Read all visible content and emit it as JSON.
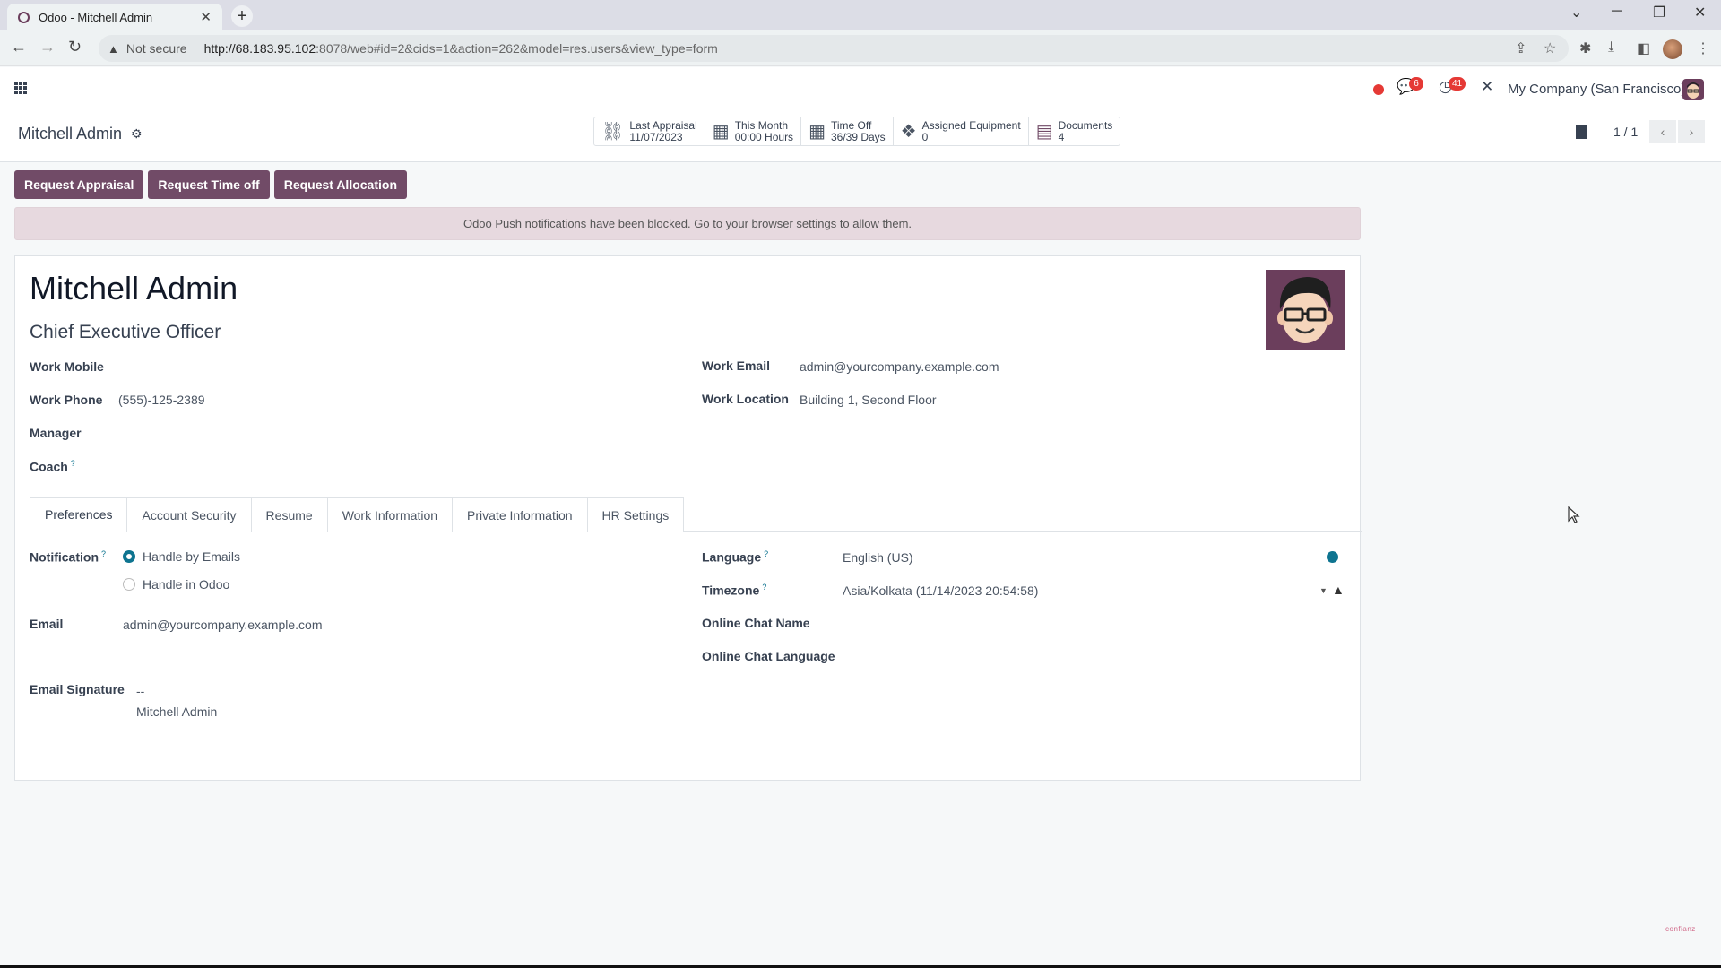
{
  "browser": {
    "tab_title": "Odoo - Mitchell Admin",
    "security_label": "Not secure",
    "url_host": "http://68.183.95.102",
    "url_rest": ":8078/web#id=2&cids=1&action=262&model=res.users&view_type=form"
  },
  "navbar": {
    "messages_badge": "6",
    "activities_badge": "41",
    "company": "My Company (San Francisco)"
  },
  "control_panel": {
    "breadcrumb": "Mitchell Admin",
    "smart_buttons": [
      {
        "icon": "sitemap-icon",
        "label": "Last Appraisal",
        "value": "11/07/2023"
      },
      {
        "icon": "calendar-icon",
        "label": "This Month",
        "value": "00:00 Hours"
      },
      {
        "icon": "calendar-icon",
        "label": "Time Off",
        "value": "36/39 Days"
      },
      {
        "icon": "cubes-icon",
        "label": "Assigned Equipment",
        "value": "0"
      },
      {
        "icon": "document-icon",
        "label": "Documents",
        "value": "4"
      }
    ],
    "pager": "1 / 1"
  },
  "actions": {
    "request_appraisal": "Request Appraisal",
    "request_time_off": "Request Time off",
    "request_allocation": "Request Allocation"
  },
  "alert": "Odoo Push notifications have been blocked. Go to your browser settings to allow them.",
  "employee": {
    "name": "Mitchell Admin",
    "job_title": "Chief Executive Officer",
    "fields_left": [
      {
        "label": "Work Mobile",
        "value": ""
      },
      {
        "label": "Work Phone",
        "value": "(555)-125-2389"
      },
      {
        "label": "Manager",
        "value": ""
      },
      {
        "label": "Coach",
        "value": "",
        "help": "?"
      }
    ],
    "fields_right": [
      {
        "label": "Work Email",
        "value": "admin@yourcompany.example.com"
      },
      {
        "label": "Work Location",
        "value": "Building 1, Second Floor"
      }
    ]
  },
  "tabs": [
    "Preferences",
    "Account Security",
    "Resume",
    "Work Information",
    "Private Information",
    "HR Settings"
  ],
  "active_tab": "Preferences",
  "preferences": {
    "notification_label": "Notification",
    "notification_options": [
      "Handle by Emails",
      "Handle in Odoo"
    ],
    "notification_selected": "Handle by Emails",
    "email_label": "Email",
    "email_value": "admin@yourcompany.example.com",
    "signature_label": "Email Signature",
    "signature_line1": "--",
    "signature_line2": "Mitchell Admin",
    "language_label": "Language",
    "language_value": "English (US)",
    "timezone_label": "Timezone",
    "timezone_value": "Asia/Kolkata (11/14/2023 20:54:58)",
    "chat_name_label": "Online Chat Name",
    "chat_language_label": "Online Chat Language",
    "help_mark": "?"
  },
  "watermark": "confianz",
  "colors": {
    "brand": "#714b67",
    "accent": "#0e7490",
    "alert_bg": "#e7d9df",
    "badge": "#e53935"
  }
}
